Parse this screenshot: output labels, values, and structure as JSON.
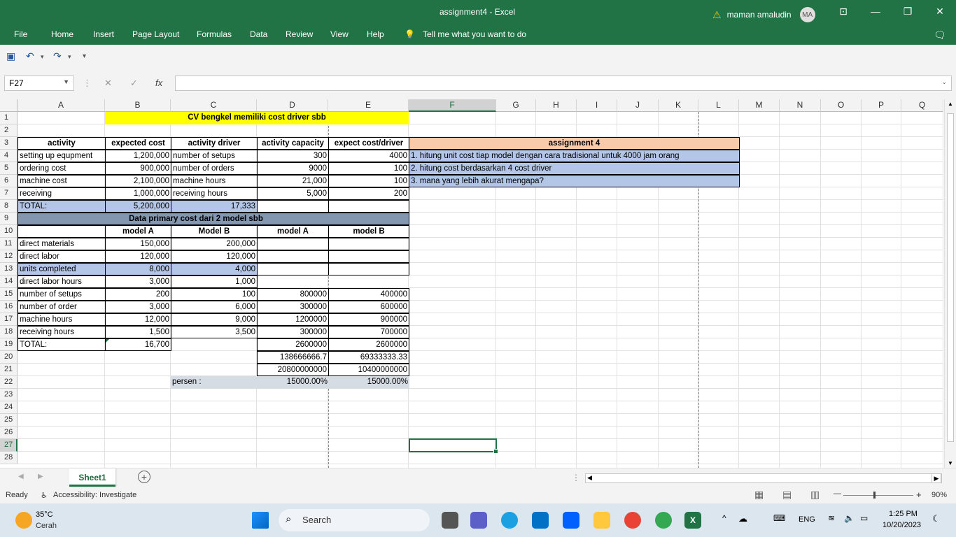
{
  "window": {
    "title": "assignment4  -  Excel",
    "user_name": "maman amaludin",
    "user_initials": "MA",
    "controls": [
      "⊡",
      "—",
      "❐",
      "✕"
    ]
  },
  "ribbon_tabs": [
    "File",
    "Home",
    "Insert",
    "Page Layout",
    "Formulas",
    "Data",
    "Review",
    "View",
    "Help"
  ],
  "tell_me": "Tell me what you want to do",
  "formula_bar": {
    "name_box": "F27",
    "fx": "fx",
    "formula": ""
  },
  "columns": [
    "A",
    "B",
    "C",
    "D",
    "E",
    "F",
    "G",
    "H",
    "I",
    "J",
    "K",
    "L",
    "M",
    "N",
    "O",
    "P",
    "Q"
  ],
  "rows": [
    "1",
    "2",
    "3",
    "4",
    "5",
    "6",
    "7",
    "8",
    "9",
    "10",
    "11",
    "12",
    "13",
    "14",
    "15",
    "16",
    "17",
    "18",
    "19",
    "20",
    "21",
    "22",
    "23",
    "24",
    "25",
    "26",
    "27",
    "28"
  ],
  "sheet": {
    "title": "CV bengkel memiliki cost driver sbb",
    "h_activity": "activity",
    "h_expected_cost": "expected cost",
    "h_activity_driver": "activity driver",
    "h_activity_capacity": "activity capacity",
    "h_expect_cost_driver": "expect cost/driver",
    "r4": [
      "setting up equpment",
      "1,200,000",
      "number of setups",
      "300",
      "4000"
    ],
    "r5": [
      "ordering cost",
      "900,000",
      "number of orders",
      "9000",
      "100"
    ],
    "r6": [
      "machine cost",
      "2,100,000",
      "machine hours",
      "21,000",
      "100"
    ],
    "r7": [
      "receiving",
      "1,000,000",
      "receiving hours",
      "5,000",
      "200"
    ],
    "r8": [
      "TOTAL:",
      "5,200,000",
      "17,333"
    ],
    "primary_title": "Data primary cost dari 2 model sbb",
    "r10": [
      "model A",
      "Model B",
      "model A",
      "model B"
    ],
    "r11": [
      "direct materials",
      "150,000",
      "200,000"
    ],
    "r12": [
      "direct labor",
      "120,000",
      "120,000"
    ],
    "r13": [
      "units completed",
      "8,000",
      "4,000"
    ],
    "r14": [
      "direct labor hours",
      "3,000",
      "1,000"
    ],
    "r15": [
      "number of setups",
      "200",
      "100",
      "800000",
      "400000"
    ],
    "r16": [
      "number of order",
      "3,000",
      "6,000",
      "300000",
      "600000"
    ],
    "r17": [
      "machine hours",
      "12,000",
      "9,000",
      "1200000",
      "900000"
    ],
    "r18": [
      "receiving hours",
      "1,500",
      "3,500",
      "300000",
      "700000"
    ],
    "r19": [
      "TOTAL:",
      "16,700",
      "2600000",
      "2600000"
    ],
    "r20": [
      "138666666.7",
      "69333333.33"
    ],
    "r21": [
      "20800000000",
      "10400000000"
    ],
    "r22": [
      "persen :",
      "15000.00%",
      "15000.00%"
    ],
    "assignment_title": "assignment 4",
    "assignment_items": [
      "1. hitung unit cost tiap model dengan cara tradisional untuk 4000 jam orang",
      "2. hitung cost berdasarkan 4 cost driver",
      "3. mana yang lebih akurat mengapa?"
    ]
  },
  "sheet_tab": "Sheet1",
  "status": {
    "ready": "Ready",
    "accessibility": "Accessibility: Investigate",
    "zoom": "90%"
  },
  "taskbar": {
    "weather_temp": "35°C",
    "weather_desc": "Cerah",
    "search": "Search",
    "lang": "ENG",
    "time": "1:25 PM",
    "date": "10/20/2023"
  },
  "colors": {
    "excel_green": "#217346",
    "yellow": "#ffff00",
    "blue_band": "#b4c6e7",
    "slate_band": "#8497b0",
    "peach": "#f8cbad",
    "gray_band": "#d6dce4"
  }
}
